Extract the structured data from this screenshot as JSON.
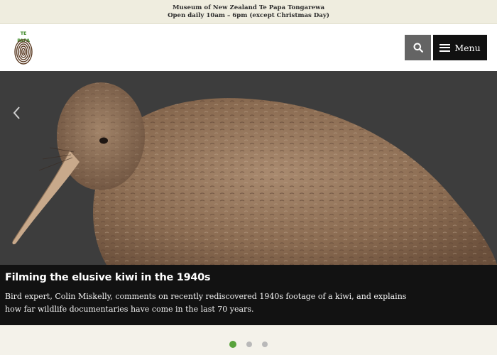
{
  "announcement": {
    "museum_name": "Museum of New Zealand Te Papa Tongarewa",
    "hours": "Open daily 10am – 6pm (except Christmas Day)"
  },
  "header": {
    "logo_text": "TE PAPA",
    "search_icon": "search-icon",
    "menu_label": "Menu",
    "menu_icon": "hamburger-icon"
  },
  "hero": {
    "prev_icon": "chevron-left-icon",
    "title": "Filming the elusive kiwi in the 1940s",
    "description": "Bird expert, Colin Miskelly, comments on recently rediscovered 1940s footage of a kiwi, and explains how far wildlife documentaries have come in the last 70 years."
  },
  "carousel": {
    "active_slide": 1,
    "total_slides": 3
  },
  "colors": {
    "accent_green": "#58a33c",
    "menu_bg": "#111111",
    "search_bg": "#646464"
  }
}
